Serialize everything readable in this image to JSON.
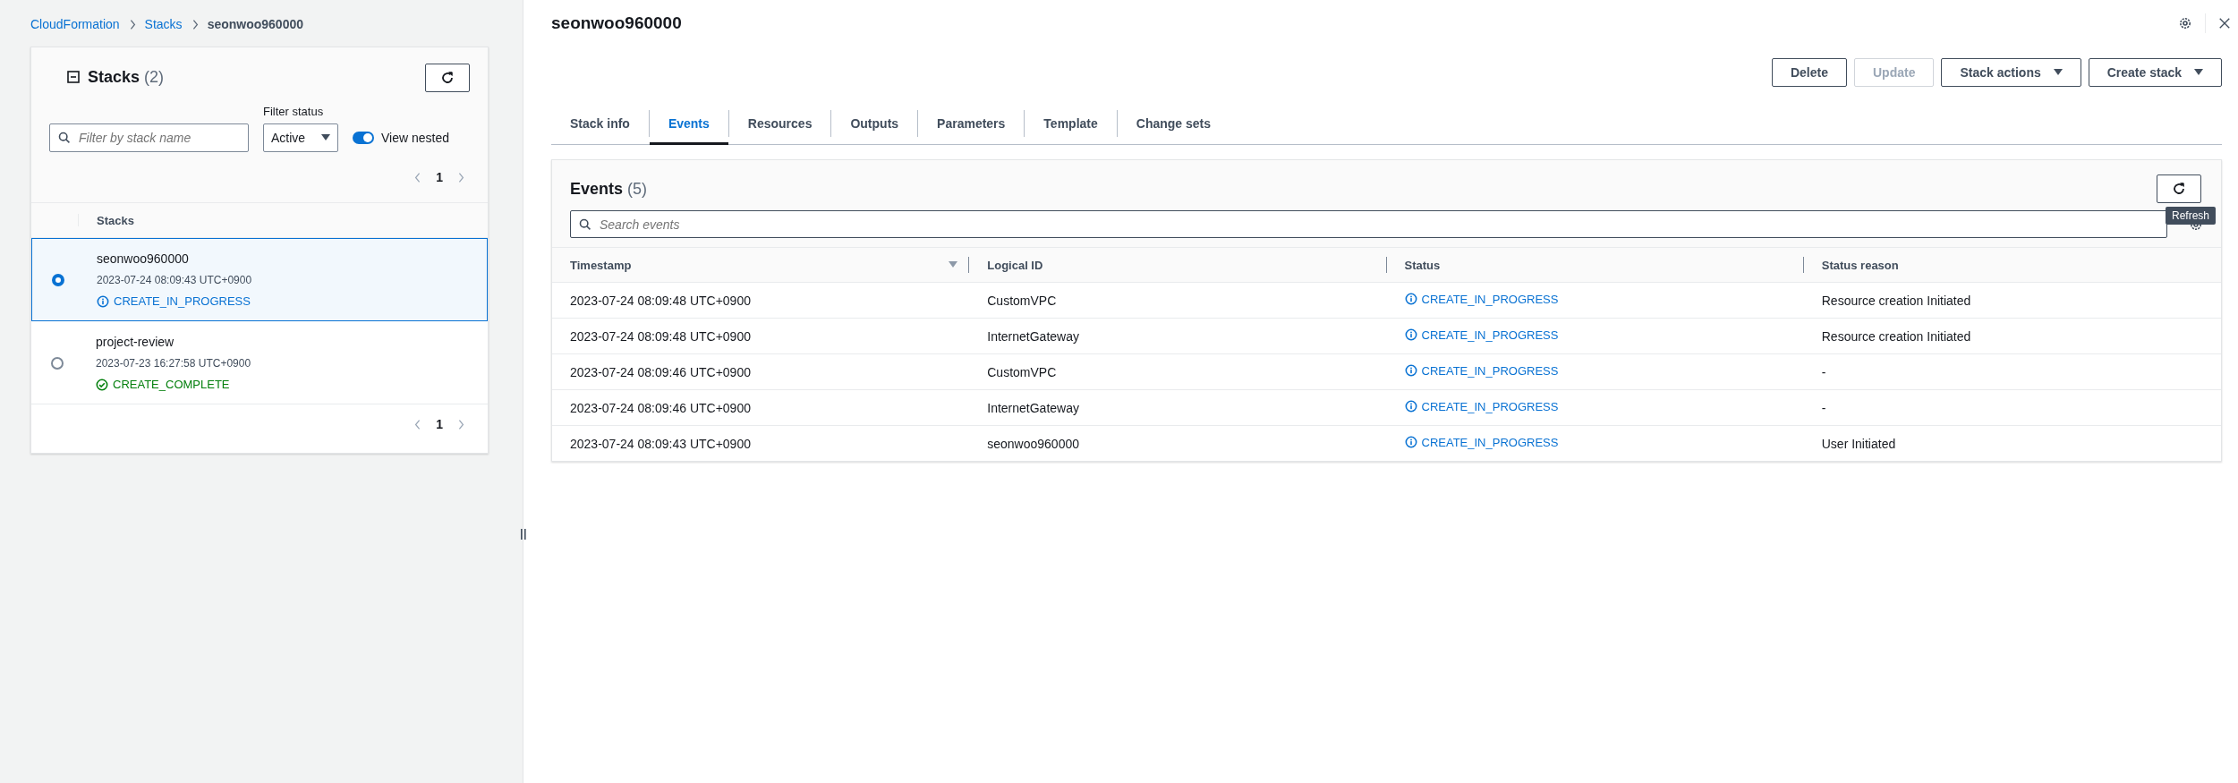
{
  "breadcrumbs": [
    {
      "label": "CloudFormation",
      "kind": "link"
    },
    {
      "label": "Stacks",
      "kind": "link"
    },
    {
      "label": "seonwoo960000",
      "kind": "current"
    }
  ],
  "stacks_panel": {
    "title": "Stacks",
    "count": "(2)",
    "filter": {
      "placeholder": "Filter by stack name"
    },
    "filter_status": {
      "label": "Filter status",
      "value": "Active"
    },
    "view_nested": {
      "label": "View nested",
      "on": true
    },
    "page": "1",
    "column": "Stacks",
    "stacks": [
      {
        "name": "seonwoo960000",
        "time": "2023-07-24 08:09:43 UTC+0900",
        "status": "CREATE_IN_PROGRESS",
        "kind": "in_progress",
        "selected": true
      },
      {
        "name": "project-review",
        "time": "2023-07-23 16:27:58 UTC+0900",
        "status": "CREATE_COMPLETE",
        "kind": "complete",
        "selected": false
      }
    ],
    "bottom_page": "1"
  },
  "detail": {
    "title": "seonwoo960000",
    "actions": [
      {
        "label": "Delete",
        "disabled": false,
        "dropdown": false
      },
      {
        "label": "Update",
        "disabled": true,
        "dropdown": false
      },
      {
        "label": "Stack actions",
        "disabled": false,
        "dropdown": true
      },
      {
        "label": "Create stack",
        "disabled": false,
        "dropdown": true
      }
    ],
    "tabs": [
      {
        "label": "Stack info",
        "selected": false
      },
      {
        "label": "Events",
        "selected": true
      },
      {
        "label": "Resources",
        "selected": false
      },
      {
        "label": "Outputs",
        "selected": false
      },
      {
        "label": "Parameters",
        "selected": false
      },
      {
        "label": "Template",
        "selected": false
      },
      {
        "label": "Change sets",
        "selected": false
      }
    ],
    "events": {
      "title": "Events",
      "count": "(5)",
      "search": {
        "placeholder": "Search events"
      },
      "refresh_tooltip": "Refresh",
      "columns": [
        "Timestamp",
        "Logical ID",
        "Status",
        "Status reason"
      ],
      "rows": [
        {
          "timestamp": "2023-07-24 08:09:48 UTC+0900",
          "logical_id": "CustomVPC",
          "status": "CREATE_IN_PROGRESS",
          "kind": "in_progress",
          "reason": "Resource creation Initiated"
        },
        {
          "timestamp": "2023-07-24 08:09:48 UTC+0900",
          "logical_id": "InternetGateway",
          "status": "CREATE_IN_PROGRESS",
          "kind": "in_progress",
          "reason": "Resource creation Initiated"
        },
        {
          "timestamp": "2023-07-24 08:09:46 UTC+0900",
          "logical_id": "CustomVPC",
          "status": "CREATE_IN_PROGRESS",
          "kind": "in_progress",
          "reason": "-"
        },
        {
          "timestamp": "2023-07-24 08:09:46 UTC+0900",
          "logical_id": "InternetGateway",
          "status": "CREATE_IN_PROGRESS",
          "kind": "in_progress",
          "reason": "-"
        },
        {
          "timestamp": "2023-07-24 08:09:43 UTC+0900",
          "logical_id": "seonwoo960000",
          "status": "CREATE_IN_PROGRESS",
          "kind": "in_progress",
          "reason": "User Initiated"
        }
      ]
    }
  }
}
